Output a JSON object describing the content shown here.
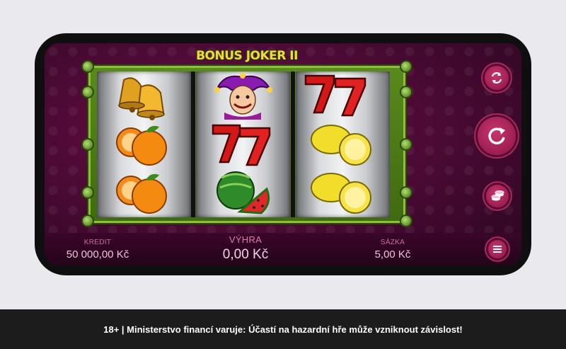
{
  "game": {
    "logo_text": "BONUS JOKER II",
    "reels": [
      [
        "bell",
        "orange",
        "orange"
      ],
      [
        "joker",
        "seven",
        "watermelon"
      ],
      [
        "seven",
        "lemon",
        "lemon"
      ]
    ]
  },
  "controls": {
    "autoplay_icon": "autoplay-icon",
    "spin_icon": "spin-icon",
    "bet_icon": "coins-icon",
    "menu_icon": "menu-icon"
  },
  "stats": {
    "credit_label": "KREDIT",
    "credit_value": "50 000,00 Kč",
    "win_label": "VÝHRA",
    "win_value": "0,00 Kč",
    "bet_label": "SÁZKA",
    "bet_value": "5,00 Kč"
  },
  "footer": {
    "warning": "18+ | Ministerstvo financí varuje: Účastí na hazardní hře může vzniknout závislost!"
  },
  "colors": {
    "accent": "#a01a55",
    "background_page": "#e9e9ee",
    "warning_bar": "#1c1c1c"
  }
}
